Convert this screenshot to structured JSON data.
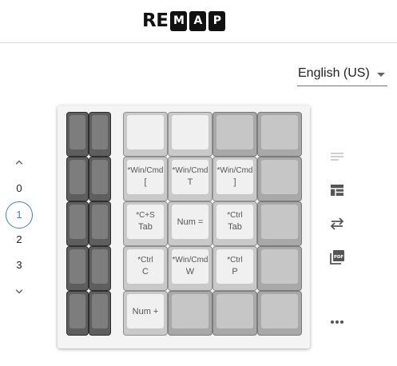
{
  "header": {
    "logo_plain_1": "R",
    "logo_plain_2": "E",
    "logo_box_1": "M",
    "logo_box_2": "A",
    "logo_box_3": "P"
  },
  "language": {
    "selected": "English (US)"
  },
  "layers": {
    "items": [
      "0",
      "1",
      "2",
      "3"
    ],
    "selected": "1"
  },
  "keyboard": {
    "rows": [
      [
        {
          "style": "light",
          "top": "",
          "main": ""
        },
        {
          "style": "light",
          "top": "",
          "main": ""
        },
        {
          "style": "gray",
          "top": "",
          "main": ""
        },
        {
          "style": "gray",
          "top": "",
          "main": ""
        }
      ],
      [
        {
          "style": "light",
          "top": "*Win/Cmd",
          "main": "["
        },
        {
          "style": "light",
          "top": "*Win/Cmd",
          "main": "T"
        },
        {
          "style": "light",
          "top": "*Win/Cmd",
          "main": "]"
        },
        {
          "style": "gray",
          "top": "",
          "main": ""
        }
      ],
      [
        {
          "style": "light",
          "top": "*C+S",
          "main": "Tab"
        },
        {
          "style": "light",
          "top": "",
          "main": "Num ="
        },
        {
          "style": "light",
          "top": "*Ctrl",
          "main": "Tab"
        },
        {
          "style": "gray",
          "top": "",
          "main": ""
        }
      ],
      [
        {
          "style": "light",
          "top": "*Ctrl",
          "main": "C"
        },
        {
          "style": "light",
          "top": "*Win/Cmd",
          "main": "W"
        },
        {
          "style": "light",
          "top": "*Ctrl",
          "main": "P"
        },
        {
          "style": "gray",
          "top": "",
          "main": ""
        }
      ],
      [
        {
          "style": "light",
          "top": "",
          "main": "Num +"
        },
        {
          "style": "gray",
          "top": "",
          "main": ""
        },
        {
          "style": "gray",
          "top": "",
          "main": ""
        },
        {
          "style": "gray",
          "top": "",
          "main": ""
        }
      ]
    ]
  },
  "tools": [
    "notes-icon",
    "layout-icon",
    "swap-icon",
    "pdf-icon",
    "more-icon"
  ],
  "colors": {
    "accent": "#3f7fc2",
    "key_light": "#f0f0f0",
    "key_gray": "#c6c6c6",
    "key_dark": "#7d7d7d"
  }
}
